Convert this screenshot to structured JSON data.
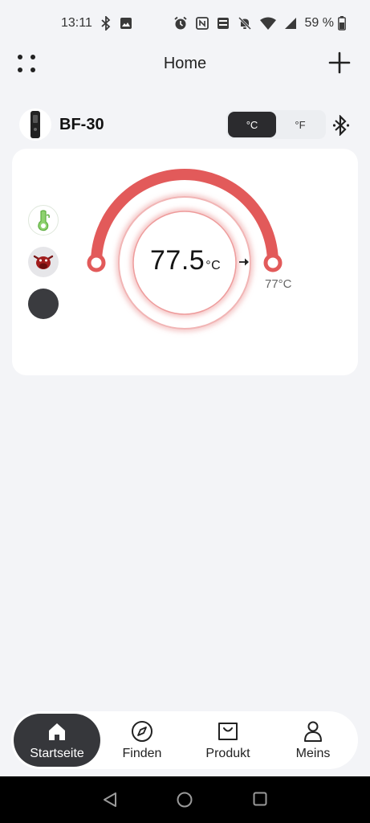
{
  "status_bar": {
    "time": "13:11",
    "battery": "59 %",
    "left_icons": [
      "bluetooth-icon",
      "image-icon"
    ],
    "right_icons": [
      "alarm-icon",
      "nfc-icon",
      "volte-icon",
      "mute-icon",
      "wifi-icon",
      "signal-icon",
      "battery-icon"
    ]
  },
  "header": {
    "title": "Home",
    "menu_icon": "dots-menu-icon",
    "add_icon": "plus-icon"
  },
  "device": {
    "name": "BF-30",
    "units": [
      "°C",
      "°F"
    ],
    "selected_unit": "°C",
    "connection_icon": "bluetooth-icon"
  },
  "probe": {
    "current_temp": "77.5",
    "current_unit": "°C",
    "target_temp": "77°C",
    "side_icons": [
      "thermometer-icon",
      "cow-icon",
      "color-dot-icon"
    ],
    "accent": "#e05656"
  },
  "bottom_nav": {
    "items": [
      {
        "label": "Startseite",
        "icon": "home-icon",
        "active": true
      },
      {
        "label": "Finden",
        "icon": "compass-icon",
        "active": false
      },
      {
        "label": "Produkt",
        "icon": "bag-icon",
        "active": false
      },
      {
        "label": "Meins",
        "icon": "person-icon",
        "active": false
      }
    ]
  },
  "system_nav": [
    "back-icon",
    "home-circle-icon",
    "recents-icon"
  ]
}
